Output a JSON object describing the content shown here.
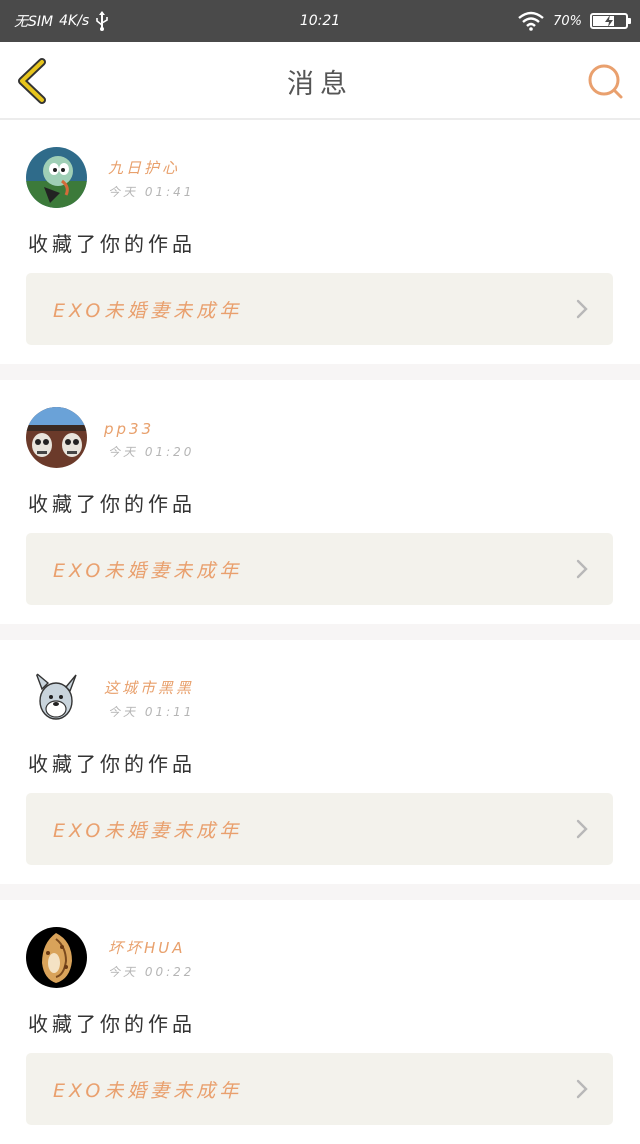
{
  "status_bar": {
    "carrier": "无SIM",
    "network_speed": "4K/s",
    "time": "10:21",
    "battery_percent": "70%",
    "battery_level": 0.7
  },
  "nav": {
    "title": "消息",
    "back_icon": "back-chevron-icon",
    "search_icon": "search-icon"
  },
  "colors": {
    "accent": "#e9a06e",
    "back_icon": "#e7c51d",
    "status_bar": "#4a4a4a",
    "card_link_bg": "#f3f2ec"
  },
  "messages": [
    {
      "user": "九日护心",
      "time": "今天 01:41",
      "action": "收藏了你的作品",
      "work_title": "EXO未婚妻未成年"
    },
    {
      "user": "pp33",
      "time": "今天 01:20",
      "action": "收藏了你的作品",
      "work_title": "EXO未婚妻未成年"
    },
    {
      "user": "这城市黑黑",
      "time": "今天 01:11",
      "action": "收藏了你的作品",
      "work_title": "EXO未婚妻未成年"
    },
    {
      "user": "坏坏HUA",
      "time": "今天 00:22",
      "action": "收藏了你的作品",
      "work_title": "EXO未婚妻未成年"
    }
  ]
}
